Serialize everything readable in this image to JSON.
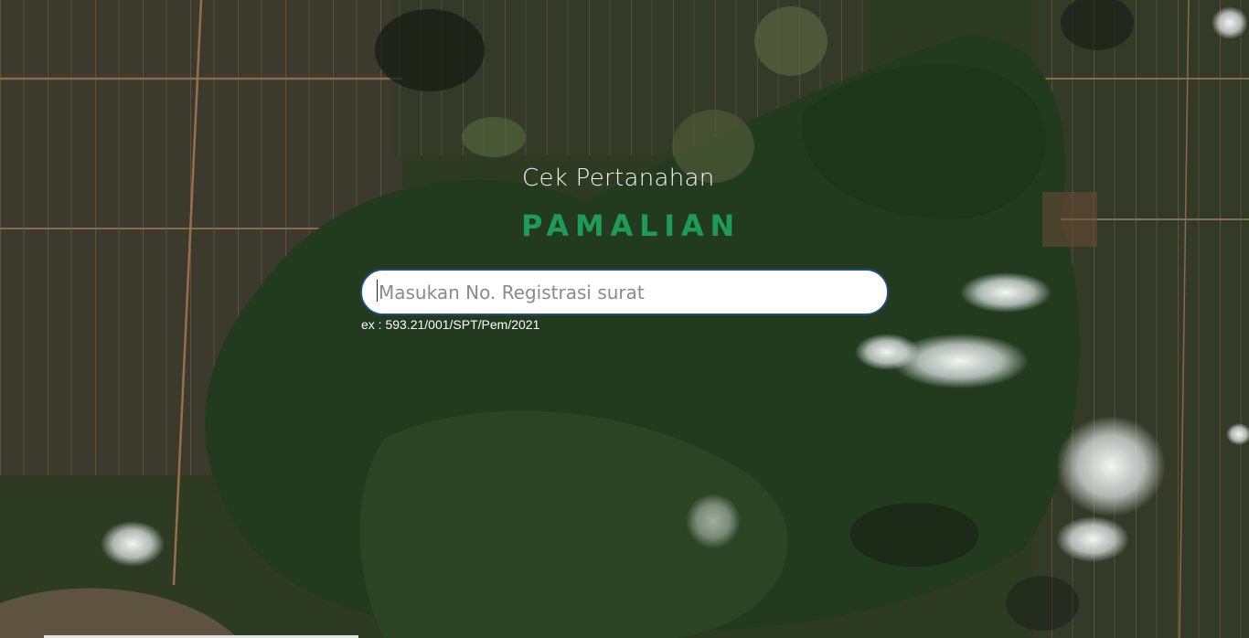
{
  "header": {
    "subtitle": "Cek Pertanahan",
    "brand": "PAMALIAN"
  },
  "search": {
    "placeholder": "Masukan No. Registrasi surat",
    "value": "",
    "hint": "ex : 593.21/001/SPT/Pem/2021"
  },
  "colors": {
    "brand": "#1f9a57",
    "input_border": "#1d4f86",
    "subtitle": "#f3f3f3"
  },
  "background": {
    "icon": "satellite-map-image"
  }
}
